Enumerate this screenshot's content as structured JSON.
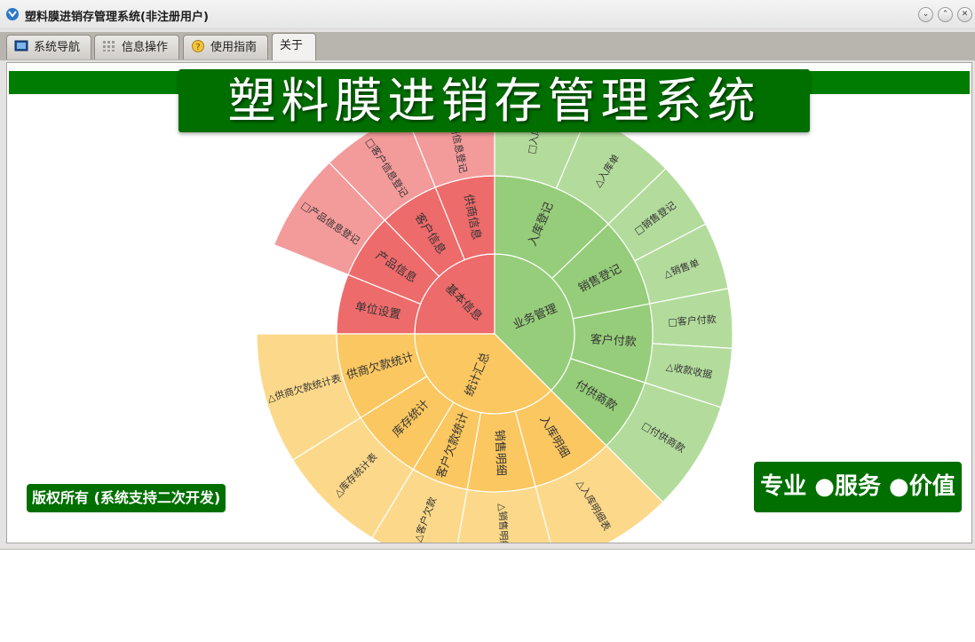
{
  "window": {
    "title": "塑料膜进销存管理系统(非注册用户)",
    "buttons": {
      "minimize": "⌄",
      "restore": "⌃",
      "close": "✕"
    }
  },
  "tabs": [
    {
      "label": "系统导航",
      "icon": "monitor-icon",
      "active": false
    },
    {
      "label": "信息操作",
      "icon": "grid-icon",
      "active": false
    },
    {
      "label": "使用指南",
      "icon": "help-icon",
      "active": false
    },
    {
      "label": "关于",
      "icon": "",
      "active": true
    }
  ],
  "banner": {
    "title": "塑料膜进销存管理系统"
  },
  "footer": {
    "copyright": "版权所有 (系统支持二次开发)",
    "slogan": "专业 ●服务 ●价值"
  },
  "colors": {
    "brand_green": "#007d00",
    "basic_info": "#ee6b6b",
    "business": "#96cd7a",
    "stats": "#fbc760"
  },
  "chart_data": {
    "type": "sunburst",
    "groups": [
      {
        "name": "基本信息",
        "color": "#ee6b6b",
        "children": [
          {
            "name": "单位设置",
            "children": []
          },
          {
            "name": "产品信息",
            "children": [
              "□产品信息登记"
            ]
          },
          {
            "name": "客户信息",
            "children": [
              "□客户信息登记"
            ]
          },
          {
            "name": "供商信息",
            "children": [
              "□供商信息登记"
            ]
          }
        ]
      },
      {
        "name": "业务管理",
        "color": "#96cd7a",
        "children": [
          {
            "name": "入库登记",
            "children": [
              "□入库",
              "△入库单"
            ]
          },
          {
            "name": "销售登记",
            "children": [
              "□销售登记",
              "△销售单"
            ]
          },
          {
            "name": "客户付款",
            "children": [
              "□客户付款",
              "△收款收据"
            ]
          },
          {
            "name": "付供商款",
            "children": [
              "□付供商款"
            ]
          }
        ]
      },
      {
        "name": "统计汇总",
        "color": "#fbc760",
        "children": [
          {
            "name": "入库明细",
            "children": [
              "△入库明细表"
            ]
          },
          {
            "name": "销售明细",
            "children": [
              "△销售明细表"
            ]
          },
          {
            "name": "客户欠款统计",
            "children": [
              "△客户欠款"
            ]
          },
          {
            "name": "库存统计",
            "children": [
              "△库存统计表"
            ]
          },
          {
            "name": "供商欠款统计",
            "children": [
              "△供商欠款统计表"
            ]
          }
        ]
      }
    ]
  }
}
